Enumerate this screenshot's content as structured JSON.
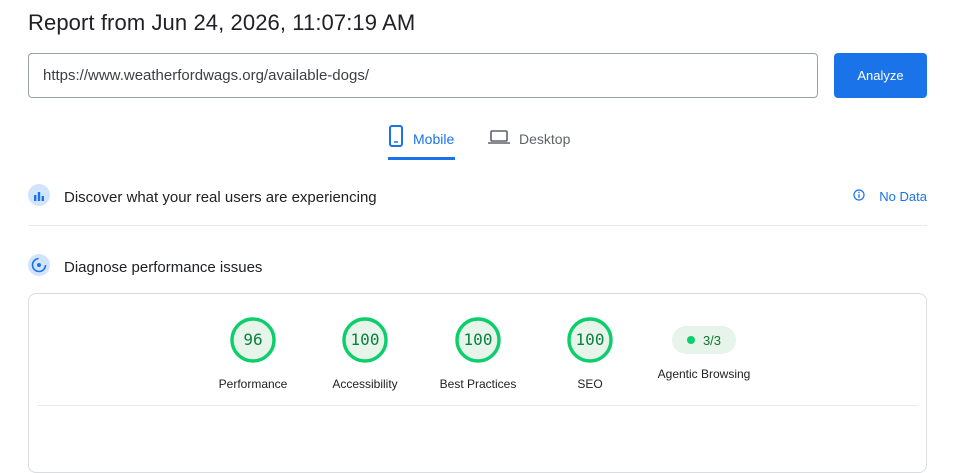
{
  "header": {
    "title": "Report from Jun 24, 2026, 11:07:19 AM"
  },
  "url_bar": {
    "value": "https://www.weatherfordwags.org/available-dogs/",
    "analyze_label": "Analyze"
  },
  "tabs": [
    {
      "label": "Mobile",
      "icon": "mobile-phone-icon",
      "active": true
    },
    {
      "label": "Desktop",
      "icon": "laptop-icon",
      "active": false
    }
  ],
  "field_data": {
    "title": "Discover what your real users are experiencing",
    "status": "No Data",
    "icon": "users-chart-icon"
  },
  "lab_data": {
    "title": "Diagnose performance issues",
    "icon": "gauge-icon"
  },
  "scores": [
    {
      "value": "96",
      "label": "Performance"
    },
    {
      "value": "100",
      "label": "Accessibility"
    },
    {
      "value": "100",
      "label": "Best Practices"
    },
    {
      "value": "100",
      "label": "SEO"
    }
  ],
  "agentic": {
    "value": "3/3",
    "label": "Agentic Browsing"
  },
  "colors": {
    "accent": "#1a73e8",
    "pass": "#0cce6b",
    "pass_text": "#0b8043"
  }
}
